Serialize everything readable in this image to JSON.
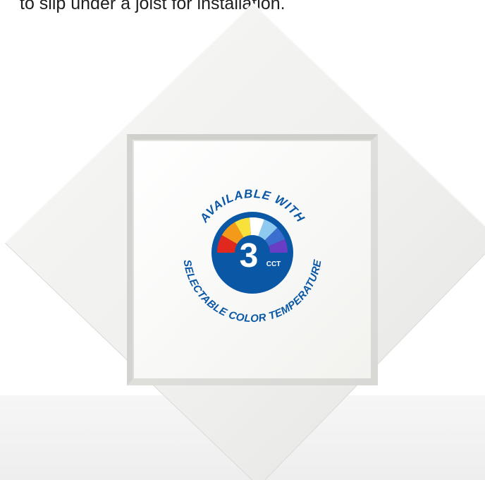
{
  "caption": {
    "text": "to slip under a joist for installation."
  },
  "product": {
    "image": "square-recessed-led-downlight-trim",
    "trim_color": "#f3f3f1",
    "lens_color": "#fbfbf9"
  },
  "badge": {
    "top_text": "AVAILABLE WITH",
    "side_text": "SELECTABLE COLOR TEMPERATURE",
    "number": "3",
    "unit": "CCT",
    "ring_color": "#0a57a6",
    "text_color": "#0a57a6",
    "spectrum_colors": [
      "#e0281e",
      "#f39a1a",
      "#f7e13a",
      "#ffffff",
      "#8fc9f0",
      "#3a6fcf",
      "#6a3ec4"
    ]
  }
}
